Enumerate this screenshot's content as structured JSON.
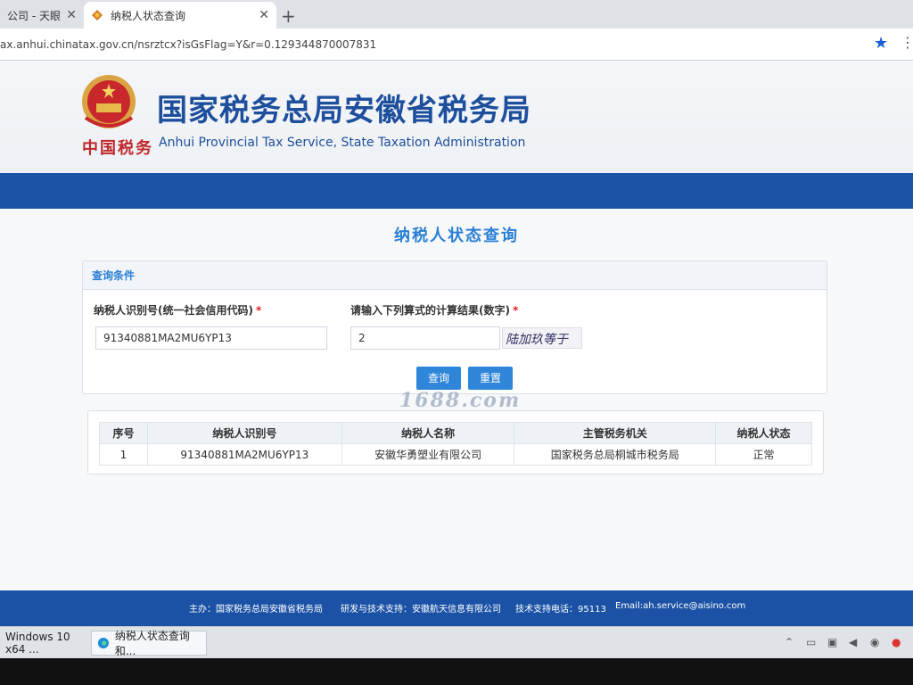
{
  "browser": {
    "tabs": [
      {
        "title": "公司 - 天眼查",
        "active": false
      },
      {
        "title": "纳税人状态查询",
        "active": true
      }
    ],
    "close_glyph": "✕",
    "new_tab_glyph": "+",
    "url": "ax.anhui.chinatax.gov.cn/nsrztcx?isGsFlag=Y&r=0.129344870007831",
    "star_icon": "★",
    "menu_icon": "⋮"
  },
  "header": {
    "title": "国家税务总局安徽省税务局",
    "subtitle": "Anhui Provincial Tax Service, State Taxation Administration",
    "slogan": "中国税务"
  },
  "main": {
    "page_heading": "纳税人状态查询",
    "panel_title": "查询条件",
    "taxpayer_id_label": "纳税人识别号(统一社会信用代码)",
    "required_mark": "*",
    "taxpayer_id_value": "91340881MA2MU6YP13",
    "calc_label": "请输入下列算式的计算结果(数字)",
    "calc_value": "2",
    "captcha_text": "陆加玖等于",
    "query_button": "查询",
    "reset_button": "重置"
  },
  "watermark": "1688.com",
  "results": {
    "columns": [
      "序号",
      "纳税人识别号",
      "纳税人名称",
      "主管税务机关",
      "纳税人状态"
    ],
    "rows": [
      [
        "1",
        "91340881MA2MU6YP13",
        "安徽华勇塑业有限公司",
        "国家税务总局桐城市税务局",
        "正常"
      ]
    ]
  },
  "footer": {
    "host": "主办：国家税务总局安徽省税务局",
    "tech": "研发与技术支持：安徽航天信息有限公司",
    "phone": "技术支持电话：95113",
    "email": "Email:ah.service@aisino.com"
  },
  "taskbar": {
    "items": [
      "Windows 10 x64 ...",
      "纳税人状态查询 和..."
    ]
  },
  "colors": {
    "brand_blue": "#1b52a6",
    "accent_blue": "#2a7fd4",
    "required_red": "#e02020"
  }
}
